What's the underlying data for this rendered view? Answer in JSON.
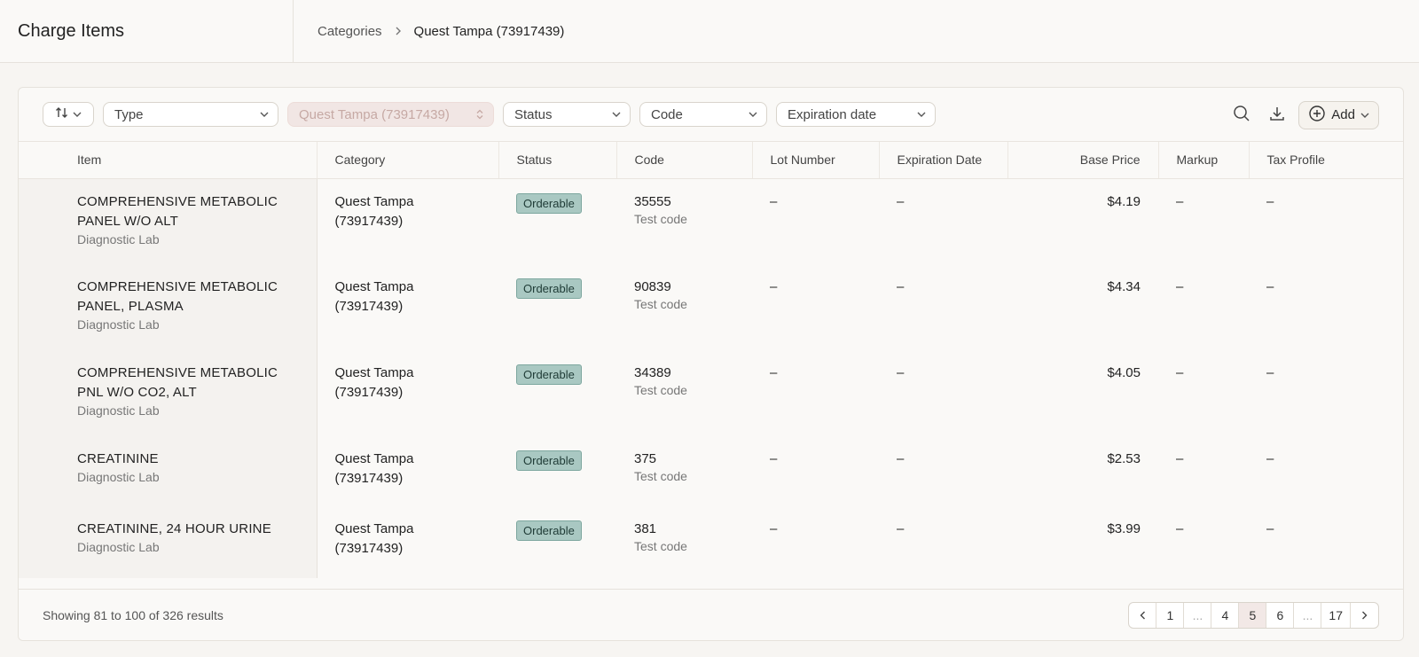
{
  "app": {
    "title": "Charge Items"
  },
  "breadcrumb": {
    "parent": "Categories",
    "current": "Quest Tampa (73917439)"
  },
  "toolbar": {
    "sort_icon": "sort-arrows-icon",
    "filters": [
      {
        "label": "Type"
      },
      {
        "label": "Quest Tampa (73917439)"
      },
      {
        "label": "Status"
      },
      {
        "label": "Code"
      },
      {
        "label": "Expiration date"
      }
    ],
    "add_label": "Add"
  },
  "table": {
    "headers": [
      "Item",
      "Category",
      "Status",
      "Code",
      "Lot Number",
      "Expiration Date",
      "Base Price",
      "Markup",
      "Tax Profile"
    ],
    "rows": [
      {
        "item": "COMPREHENSIVE METABOLIC PANEL W/O ALT",
        "item_sub": "Diagnostic Lab",
        "category": "Quest Tampa (73917439)",
        "status": "Orderable",
        "code": "35555",
        "code_sub": "Test code",
        "lot": "–",
        "expiration": "–",
        "price": "$4.19",
        "markup": "–",
        "tax": "–"
      },
      {
        "item": "COMPREHENSIVE METABOLIC PANEL, PLASMA",
        "item_sub": "Diagnostic Lab",
        "category": "Quest Tampa (73917439)",
        "status": "Orderable",
        "code": "90839",
        "code_sub": "Test code",
        "lot": "–",
        "expiration": "–",
        "price": "$4.34",
        "markup": "–",
        "tax": "–"
      },
      {
        "item": "COMPREHENSIVE METABOLIC PNL W/O CO2, ALT",
        "item_sub": "Diagnostic Lab",
        "category": "Quest Tampa (73917439)",
        "status": "Orderable",
        "code": "34389",
        "code_sub": "Test code",
        "lot": "–",
        "expiration": "–",
        "price": "$4.05",
        "markup": "–",
        "tax": "–"
      },
      {
        "item": "CREATININE",
        "item_sub": "Diagnostic Lab",
        "category": "Quest Tampa (73917439)",
        "status": "Orderable",
        "code": "375",
        "code_sub": "Test code",
        "lot": "–",
        "expiration": "–",
        "price": "$2.53",
        "markup": "–",
        "tax": "–"
      },
      {
        "item": "CREATININE, 24 HOUR URINE",
        "item_sub": "Diagnostic Lab",
        "category": "Quest Tampa (73917439)",
        "status": "Orderable",
        "code": "381",
        "code_sub": "Test code",
        "lot": "–",
        "expiration": "–",
        "price": "$3.99",
        "markup": "–",
        "tax": "–"
      }
    ]
  },
  "footer": {
    "results": "Showing 81 to 100 of 326 results",
    "pages": [
      "1",
      "...",
      "4",
      "5",
      "6",
      "...",
      "17"
    ],
    "active_page": "5"
  },
  "colors": {
    "badge_bg": "#a9c8c2",
    "active_page_bg": "#f2e8e6"
  }
}
